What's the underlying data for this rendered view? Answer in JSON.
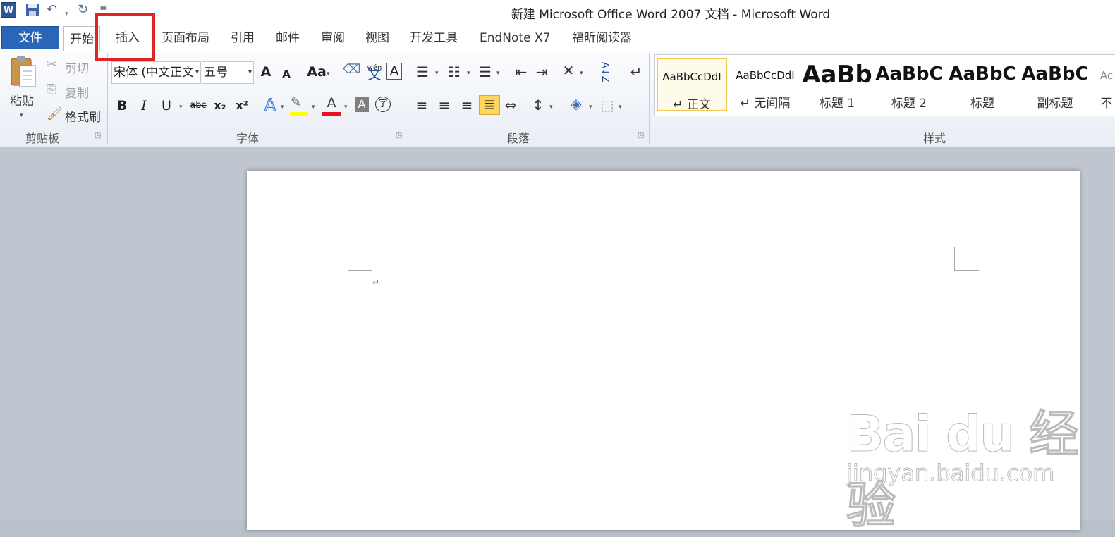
{
  "window": {
    "title": "新建 Microsoft Office Word 2007 文档 - Microsoft Word"
  },
  "qat": {
    "app_icon_letter": "W",
    "customize": "="
  },
  "tabs": {
    "file": "文件",
    "items": [
      "开始",
      "插入",
      "页面布局",
      "引用",
      "邮件",
      "审阅",
      "视图",
      "开发工具",
      "EndNote X7",
      "福昕阅读器"
    ]
  },
  "clipboard": {
    "paste": "粘贴",
    "cut": "剪切",
    "copy": "复制",
    "format_painter": "格式刷",
    "group_label": "剪贴板"
  },
  "font": {
    "font_name": "宋体 (中文正文",
    "font_size": "五号",
    "grow": "A",
    "shrink": "A",
    "change_case": "Aa",
    "phonetic": "wén",
    "phonetic_char": "文",
    "bold": "B",
    "italic": "I",
    "underline": "U",
    "strike": "abc",
    "subscript": "x₂",
    "superscript": "x²",
    "text_effects": "A",
    "font_color": "A",
    "shading": "A",
    "enclose": "字",
    "highlight_color": "#ffff00",
    "font_color_value": "#e81123",
    "group_label": "字体"
  },
  "paragraph": {
    "group_label": "段落",
    "sort": "A↓Z"
  },
  "styles": {
    "group_label": "样式",
    "items": [
      {
        "preview": "AaBbCcDdI",
        "name": "↵ 正文"
      },
      {
        "preview": "AaBbCcDdI",
        "name": "↵ 无间隔"
      },
      {
        "preview": "AaBb",
        "name": "标题 1"
      },
      {
        "preview": "AaBbC",
        "name": "标题 2"
      },
      {
        "preview": "AaBbC",
        "name": "标题"
      },
      {
        "preview": "AaBbC",
        "name": "副标题"
      },
      {
        "preview": "Ac",
        "name": "不"
      }
    ]
  },
  "document": {
    "paragraph_mark": "↵"
  },
  "watermark": {
    "main": "Bai du 经验",
    "sub": "jingyan.baidu.com"
  },
  "colors": {
    "file_tab": "#2a66b8",
    "annotation_box": "#e02525",
    "selected_style": "#f2c54f"
  }
}
